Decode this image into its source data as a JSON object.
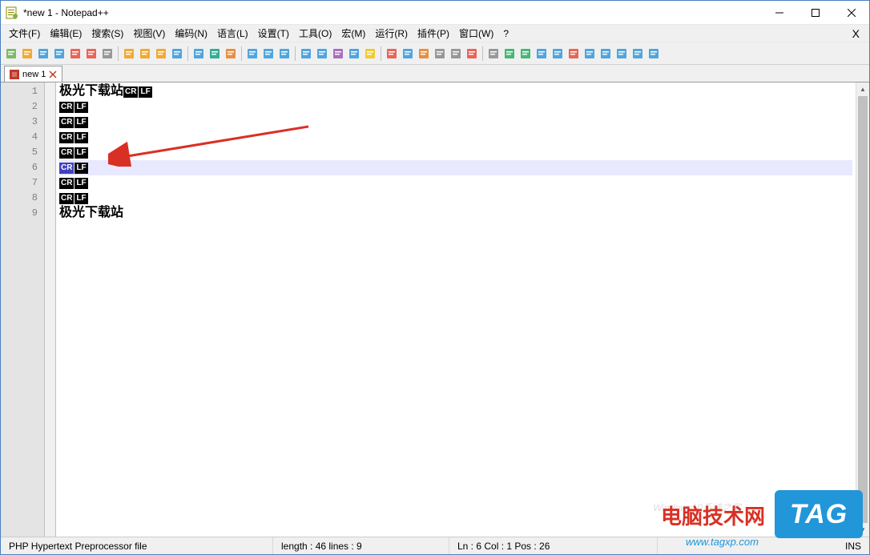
{
  "window": {
    "title": "*new 1 - Notepad++"
  },
  "menus": [
    "文件(F)",
    "编辑(E)",
    "搜索(S)",
    "视图(V)",
    "编码(N)",
    "语言(L)",
    "设置(T)",
    "工具(O)",
    "宏(M)",
    "运行(R)",
    "插件(P)",
    "窗口(W)",
    "?"
  ],
  "tab": {
    "label": "new 1"
  },
  "lines": [
    {
      "n": 1,
      "text": "极光下载站",
      "eol": true,
      "current": false
    },
    {
      "n": 2,
      "text": "",
      "eol": true,
      "current": false
    },
    {
      "n": 3,
      "text": "",
      "eol": true,
      "current": false
    },
    {
      "n": 4,
      "text": "",
      "eol": true,
      "current": false
    },
    {
      "n": 5,
      "text": "",
      "eol": true,
      "current": false
    },
    {
      "n": 6,
      "text": "",
      "eol": true,
      "current": true
    },
    {
      "n": 7,
      "text": "",
      "eol": true,
      "current": false
    },
    {
      "n": 8,
      "text": "",
      "eol": true,
      "current": false
    },
    {
      "n": 9,
      "text": "极光下载站",
      "eol": false,
      "current": false
    }
  ],
  "eol": {
    "cr": "CR",
    "lf": "LF"
  },
  "status": {
    "filetype": "PHP Hypertext Preprocessor file",
    "length": "length : 46    lines : 9",
    "pos": "Ln : 6    Col : 1    Pos : 26",
    "ins": "INS"
  },
  "watermark": {
    "main": "电脑技术网",
    "tag": "TAG",
    "url": "www.tagxp.com"
  },
  "tool_icons": [
    "new-file-icon",
    "open-file-icon",
    "save-icon",
    "save-all-icon",
    "close-icon",
    "close-all-icon",
    "print-icon",
    "cut-icon",
    "copy-icon",
    "paste-icon",
    "undo-icon",
    "redo-icon",
    "find-icon",
    "replace-icon",
    "zoom-in-icon",
    "zoom-out-icon",
    "sync-v-icon",
    "sync-h-icon",
    "wrap-icon",
    "all-chars-icon",
    "indent-icon",
    "folder-icon",
    "doc-map-icon",
    "doc-list-icon",
    "func-list-icon",
    "folder-tree-icon",
    "monitor-icon",
    "record-icon",
    "stop-icon",
    "play-icon",
    "play-multi-icon",
    "save-macro-icon",
    "spacer1",
    "spacer2",
    "spacer3",
    "spacer4",
    "spacer5",
    "spacer6",
    "spacer7"
  ]
}
